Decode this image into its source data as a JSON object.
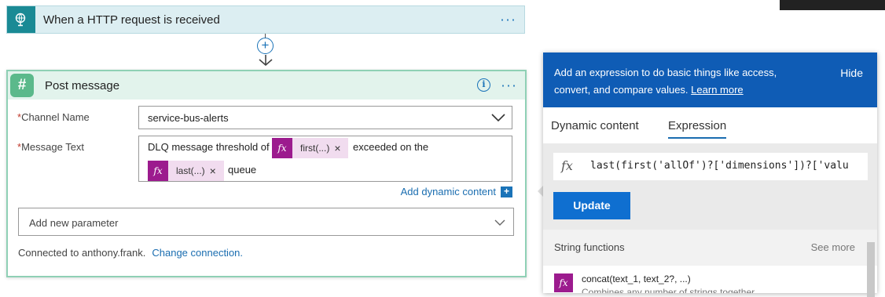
{
  "trigger": {
    "title": "When a HTTP request is received",
    "menu": "···"
  },
  "connector": {
    "plus": "+"
  },
  "action": {
    "title": "Post message",
    "info": "i",
    "menu": "···",
    "channel_label": "Channel Name",
    "channel_value": "service-bus-alerts",
    "message_label": "Message Text",
    "required_mark": "*",
    "msg_prefix": "DLQ message threshold of",
    "token1": "first(...)",
    "msg_middle": "exceeded on the",
    "token2": "last(...)",
    "msg_suffix": "queue",
    "token_fx": "fx",
    "token_remove": "×",
    "add_dynamic": "Add dynamic content",
    "add_dynamic_plus": "+",
    "add_param_placeholder": "Add new parameter",
    "connected_text": "Connected to anthony.frank.",
    "change_connection": "Change connection."
  },
  "panel": {
    "description": "Add an expression to do basic things like access, convert, and compare values.",
    "learn_more": "Learn more",
    "hide": "Hide",
    "tab_dynamic": "Dynamic content",
    "tab_expression": "Expression",
    "fx": "fx",
    "expression": "last(first('allOf')?['dimensions'])?['valu",
    "update": "Update",
    "section_title": "String functions",
    "see_more": "See more",
    "fn_name": "concat(text_1, text_2?, ...)",
    "fn_desc": "Combines any number of strings together"
  },
  "colors": {
    "accent": "#0f5cb5",
    "token": "#9c1b8e",
    "trigger": "#1a8a95",
    "slack": "#5bb98b"
  }
}
